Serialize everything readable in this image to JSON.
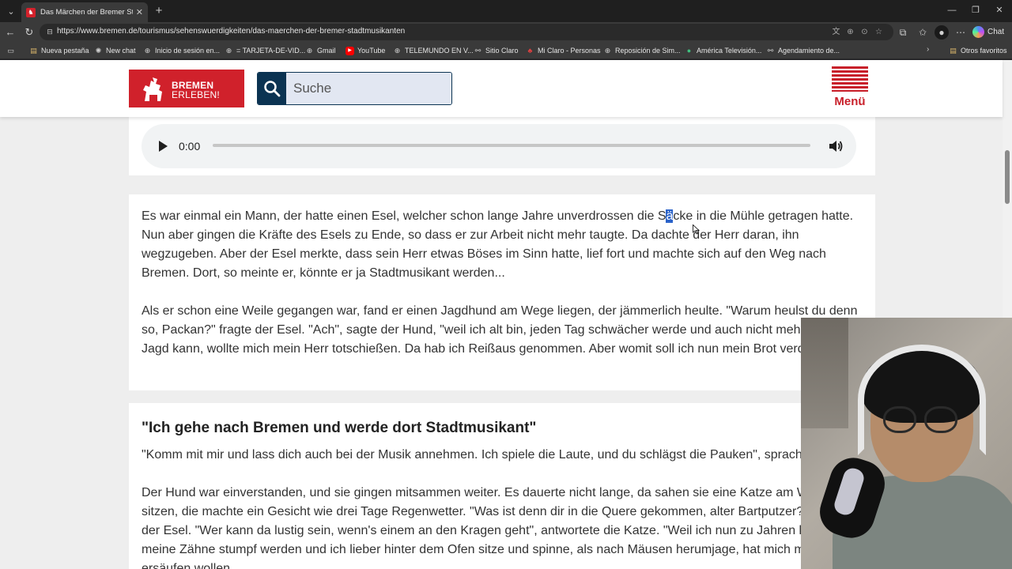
{
  "browser": {
    "tab": {
      "title": "Das Märchen der Bremer Stadtmu",
      "favicon": "bremen-favicon"
    },
    "url": "https://www.bremen.de/tourismus/sehenswuerdigkeiten/das-maerchen-der-bremer-stadtmusikanten",
    "chat_label": "Chat",
    "bookmarks": [
      {
        "label": "Nueva pestaña",
        "icon": "folder-icon"
      },
      {
        "label": "New chat",
        "icon": "chat-icon"
      },
      {
        "label": "Inicio de sesión en...",
        "icon": "globe-icon"
      },
      {
        "label": "= TARJETA-DE-VID...",
        "icon": "globe-icon"
      },
      {
        "label": "Gmail",
        "icon": "globe-icon"
      },
      {
        "label": "YouTube",
        "icon": "youtube-icon"
      },
      {
        "label": "TELEMUNDO EN V...",
        "icon": "globe-icon"
      },
      {
        "label": "Sitio Claro",
        "icon": "link-icon"
      },
      {
        "label": "Mi Claro - Personas",
        "icon": "claro-icon"
      },
      {
        "label": "Reposición de Sim...",
        "icon": "globe-icon"
      },
      {
        "label": "América Televisión...",
        "icon": "globe-icon"
      },
      {
        "label": "Agendamiento de...",
        "icon": "link-icon"
      }
    ],
    "other_bookmarks": "Otros favoritos"
  },
  "site": {
    "logo": {
      "line1": "BREMEN",
      "line2": "ERLEBEN!"
    },
    "search": {
      "placeholder": "Suche"
    },
    "menu_label": "Menü"
  },
  "audio": {
    "time": "0:00",
    "progress": 0
  },
  "story": {
    "p1_before": "Es war einmal ein Mann, der hatte einen Esel, welcher schon lange Jahre unverdrossen die S",
    "p1_highlight": "ä",
    "p1_after": "cke in die Mühle getragen hatte. Nun aber gingen die Kräfte des Esels zu Ende, so dass er zur Arbeit nicht mehr taugte. Da dachte der Herr daran, ihn wegzugeben. Aber der Esel merkte, dass sein Herr etwas Böses im Sinn hatte, lief fort und machte sich auf den Weg nach Bremen. Dort, so meinte er, könnte er ja Stadtmusikant werden...",
    "p2": "Als er schon eine Weile gegangen war, fand er einen Jagdhund am Wege liegen, der jämmerlich heulte. \"Warum heulst du denn so, Packan?\" fragte der Esel. \"Ach\", sagte der Hund, \"weil ich alt bin, jeden Tag schwächer werde und auch nicht mehr auf die Jagd kann, wollte mich mein Herr totschießen. Da hab ich Reißaus genommen. Aber womit soll ich nun mein Brot verdienen?\""
  },
  "section": {
    "heading": "\"Ich gehe nach Bremen und werde dort Stadtmusikant\"",
    "p1": "\"Komm mit mir und lass dich auch bei der Musik annehmen. Ich spiele die Laute, und du schlägst die Pauken\", sprach der Esel.",
    "p2": "Der Hund war einverstanden, und sie gingen mitsammen weiter. Es dauerte nicht lange, da sahen sie eine Katze am Wege sitzen, die machte ein Gesicht wie drei Tage Regenwetter. \"Was ist denn dir in die Quere gekommen, alter Bartputzer?\" fragte der Esel. \"Wer kann da lustig sein, wenn's einem an den Kragen geht\", antwortete die Katze. \"Weil ich nun zu Jahren komme, meine Zähne stumpf werden und ich lieber hinter dem Ofen sitze und spinne, als nach Mäusen herumjage, hat mich meine Frau ersäufen wollen."
  }
}
